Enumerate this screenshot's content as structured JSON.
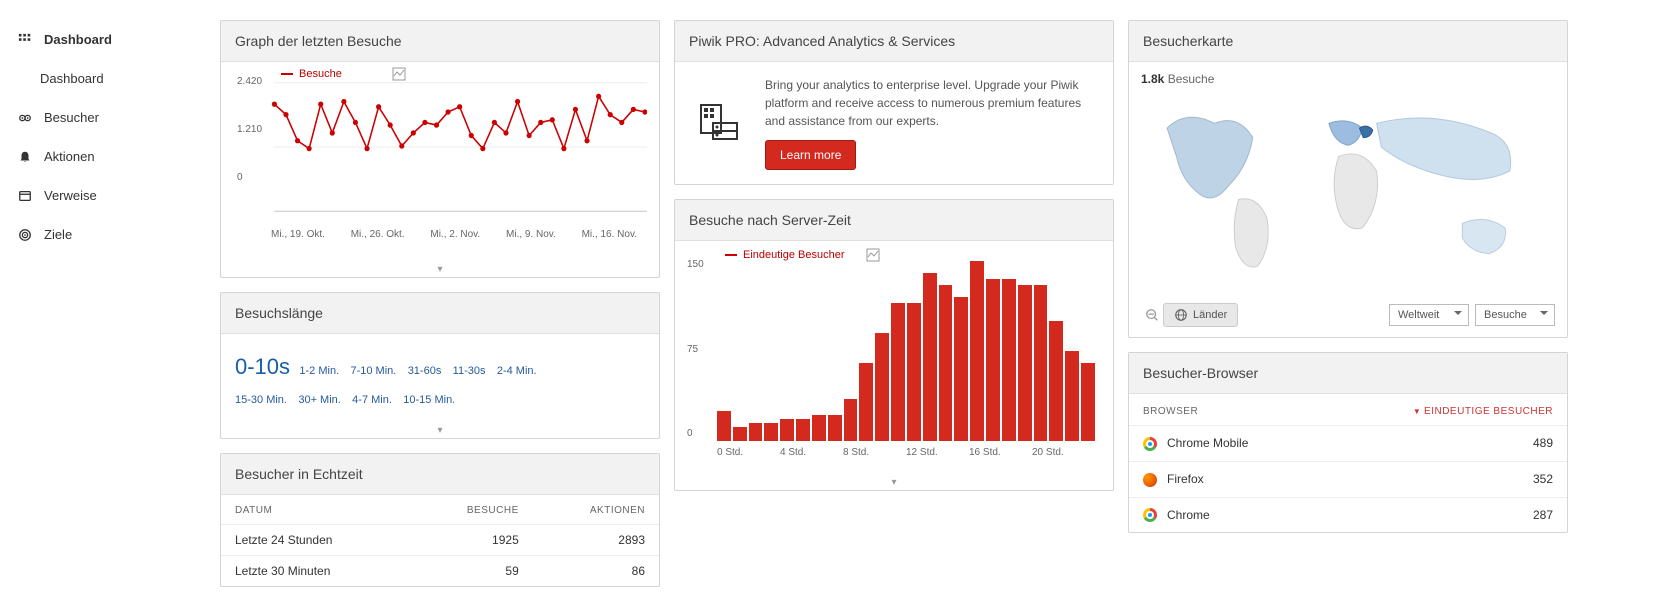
{
  "sidebar": {
    "items": [
      {
        "label": "Dashboard",
        "icon": "grid"
      },
      {
        "label": "Dashboard",
        "sub": true
      },
      {
        "label": "Besucher",
        "icon": "eyes"
      },
      {
        "label": "Aktionen",
        "icon": "bell"
      },
      {
        "label": "Verweise",
        "icon": "window"
      },
      {
        "label": "Ziele",
        "icon": "target"
      }
    ]
  },
  "visitsGraph": {
    "title": "Graph der letzten Besuche",
    "legend": "Besuche",
    "xLabels": [
      "Mi., 19. Okt.",
      "Mi., 26. Okt.",
      "Mi., 2. Nov.",
      "Mi., 9. Nov.",
      "Mi., 16. Nov."
    ],
    "yTicks": [
      "2.420",
      "1.210",
      "0"
    ]
  },
  "visitLength": {
    "title": "Besuchslänge",
    "primary": "0-10s",
    "buckets": [
      "1-2 Min.",
      "7-10 Min.",
      "31-60s",
      "11-30s",
      "2-4 Min.",
      "15-30 Min.",
      "30+ Min.",
      "4-7 Min.",
      "10-15 Min."
    ]
  },
  "realtime": {
    "title": "Besucher in Echtzeit",
    "headers": {
      "date": "DATUM",
      "visits": "BESUCHE",
      "actions": "AKTIONEN"
    },
    "rows": [
      {
        "date": "Letzte 24 Stunden",
        "visits": "1925",
        "actions": "2893"
      },
      {
        "date": "Letzte 30 Minuten",
        "visits": "59",
        "actions": "86"
      }
    ]
  },
  "promo": {
    "title": "Piwik PRO: Advanced Analytics & Services",
    "text": "Bring your analytics to enterprise level. Upgrade your Piwik platform and receive access to numerous premium features and assistance from our experts.",
    "button": "Learn more"
  },
  "serverTime": {
    "title": "Besuche nach Server-Zeit",
    "legend": "Eindeutige Besucher",
    "yTicks": [
      "150",
      "75",
      "0"
    ],
    "xLabels": [
      "0 Std.",
      "4 Std.",
      "8 Std.",
      "12 Std.",
      "16 Std.",
      "20 Std."
    ]
  },
  "visitorMap": {
    "title": "Besucherkarte",
    "statValue": "1.8k",
    "statLabel": "Besuche",
    "countriesBtn": "Länder",
    "regionSel": "Weltweit",
    "metricSel": "Besuche"
  },
  "browsers": {
    "title": "Besucher-Browser",
    "headers": {
      "browser": "BROWSER",
      "unique": "EINDEUTIGE BESUCHER"
    },
    "rows": [
      {
        "name": "Chrome Mobile",
        "value": "489",
        "icon": "chrome"
      },
      {
        "name": "Firefox",
        "value": "352",
        "icon": "firefox"
      },
      {
        "name": "Chrome",
        "value": "287",
        "icon": "chrome"
      }
    ]
  },
  "chart_data": [
    {
      "type": "line",
      "title": "Graph der letzten Besuche",
      "series": [
        {
          "name": "Besuche",
          "values": [
            2050,
            1850,
            1350,
            1200,
            2050,
            1500,
            2100,
            1700,
            1200,
            2000,
            1650,
            1250,
            1500,
            1700,
            1650,
            1900,
            2000,
            1450,
            1200,
            1700,
            1500,
            2100,
            1450,
            1700,
            1750,
            1200,
            1950,
            1350,
            2200,
            1850,
            1700,
            1950,
            1900
          ]
        }
      ],
      "ylim": [
        0,
        2420
      ],
      "x_categories_shown": [
        "Mi., 19. Okt.",
        "Mi., 26. Okt.",
        "Mi., 2. Nov.",
        "Mi., 9. Nov.",
        "Mi., 16. Nov."
      ]
    },
    {
      "type": "bar",
      "title": "Besuche nach Server-Zeit",
      "categories": [
        "0",
        "1",
        "2",
        "3",
        "4",
        "5",
        "6",
        "7",
        "8",
        "9",
        "10",
        "11",
        "12",
        "13",
        "14",
        "15",
        "16",
        "17",
        "18",
        "19",
        "20",
        "21",
        "22",
        "23"
      ],
      "series": [
        {
          "name": "Eindeutige Besucher",
          "values": [
            25,
            12,
            15,
            15,
            18,
            18,
            22,
            22,
            35,
            65,
            90,
            115,
            115,
            140,
            130,
            120,
            150,
            135,
            135,
            130,
            130,
            100,
            75,
            65
          ]
        }
      ],
      "ylim": [
        0,
        150
      ],
      "xlabel": "Std.",
      "ylabel": ""
    }
  ]
}
